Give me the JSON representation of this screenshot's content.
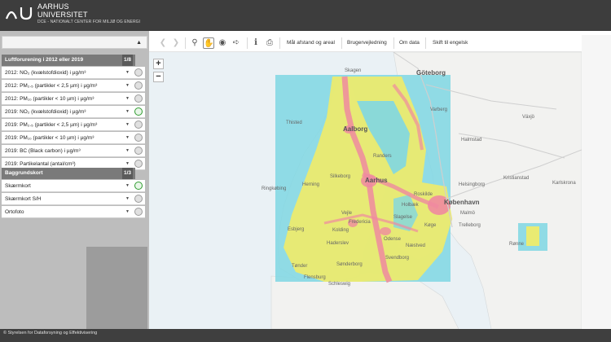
{
  "header": {
    "university_line1": "AARHUS",
    "university_line2": "UNIVERSITET",
    "department": "DCE - NATIONALT CENTER FOR MILJØ OG ENERGI"
  },
  "sidebar": {
    "groups": [
      {
        "title": "Luftforurening i 2012 eller 2019",
        "count": "1/8",
        "layers": [
          {
            "label": "2012: NO₂ (kvælstofdioxid) i µg/m³",
            "active": false
          },
          {
            "label": "2012: PM₂.₅ (partikler < 2,5 µm) i µg/m³",
            "active": false
          },
          {
            "label": "2012: PM₁₀ (partikler < 10 µm) i µg/m³",
            "active": false
          },
          {
            "label": "2019: NO₂ (kvælstofdioxid) i µg/m³",
            "active": true
          },
          {
            "label": "2019: PM₂.₅ (partikler < 2,5 µm) i µg/m³",
            "active": false
          },
          {
            "label": "2019: PM₁₀ (partikler < 10 µm) i µg/m³",
            "active": false
          },
          {
            "label": "2019: BC (Black carbon) i µg/m³",
            "active": false
          },
          {
            "label": "2019: Partikelantal (antal/cm³)",
            "active": false
          }
        ]
      },
      {
        "title": "Baggrundskort",
        "count": "1/3",
        "layers": [
          {
            "label": "Skærmkort",
            "active": true
          },
          {
            "label": "Skærmkort S/H",
            "active": false
          },
          {
            "label": "Ortofoto",
            "active": false
          }
        ]
      }
    ]
  },
  "toolbar": {
    "icons": [
      "back-icon",
      "forward-icon",
      "zoom-icon",
      "pan-hand-icon",
      "globe-icon",
      "measure-pointer-icon",
      "info-icon",
      "print-icon"
    ],
    "buttons": [
      "Mål afstand og areal",
      "Brugervejledning",
      "Om data",
      "Skift til engelsk"
    ]
  },
  "map": {
    "zoom_in": "+",
    "zoom_out": "−",
    "places": [
      "Skagen",
      "Göteborg",
      "Thisted",
      "Aalborg",
      "Randers",
      "Ringkøbing",
      "Herning",
      "Silkeborg",
      "Aarhus",
      "Vejle",
      "Esbjerg",
      "Kolding",
      "Fredericia",
      "Odense",
      "Haderslev",
      "Svendborg",
      "Tønder",
      "Sønderborg",
      "Helsingborg",
      "København",
      "Malmö",
      "Trelleborg",
      "Roskilde",
      "Køge",
      "Næstved",
      "Slagelse",
      "Halmstad",
      "Växjö",
      "Varberg",
      "Kristianstad",
      "Karlskrona",
      "Rønne",
      "Flensburg",
      "Schleswig",
      "Holbæk"
    ],
    "colors": {
      "sea": "#eaf1f5",
      "land": "#f2f2f0",
      "level_low": "#7fd7e3",
      "level_mid": "#f3ec65",
      "level_high": "#ef8aa0"
    }
  },
  "footer": {
    "text": "© Styrelsen for Dataforsyning og Effektivisering"
  }
}
